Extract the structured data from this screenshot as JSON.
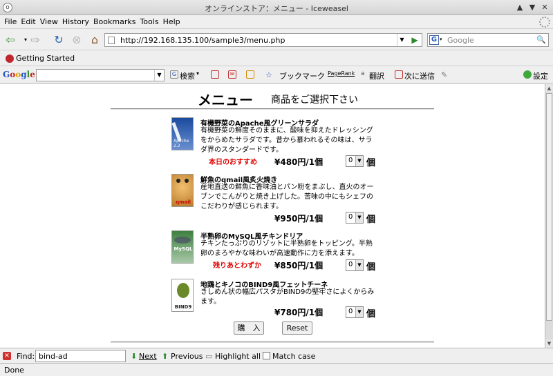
{
  "window": {
    "title": "オンラインストア：メニュー - Iceweasel"
  },
  "menubar": [
    "File",
    "Edit",
    "View",
    "History",
    "Bookmarks",
    "Tools",
    "Help"
  ],
  "nav": {
    "url": "http://192.168.135.100/sample3/menu.php",
    "search_placeholder": "Google"
  },
  "bookmarks": {
    "item": "Getting Started"
  },
  "google_toolbar": {
    "logo": "Google",
    "search": "検索",
    "bookmarks": "ブックマーク",
    "pagerank": "PageRank",
    "translate": "翻訳",
    "send": "次に送信",
    "settings": "設定"
  },
  "page": {
    "title": "メニュー",
    "subtitle": "商品をご選択下さい",
    "items": [
      {
        "name": "有機野菜のApache風グリーンサラダ",
        "desc": "有機野菜の鮮度そのままに、酸味を抑えたドレッシングをからめたサラダです。昔から慕われるその味は、サラダ界のスタンダードです。",
        "badge": "本日のおすすめ",
        "price": "¥480円/1個",
        "qty": "0",
        "unit": "個",
        "thumb_label": "Apache 2.2"
      },
      {
        "name": "鮮魚のqmail風炙火焼き",
        "desc": "産地直送の鮮魚に香味油とパン粉をまぶし、直火のオーブンでこんがりと焼き上げした。苦味の中にもシェフのこだわりが感じられます。",
        "badge": "",
        "price": "¥950円/1個",
        "qty": "0",
        "unit": "個",
        "thumb_label": "qmail"
      },
      {
        "name": "半熟卵のMySQL風チキンドリア",
        "desc": "チキンたっぷりのリゾットに半熟卵をトッピング。半熟卵のまろやかな味わいが高速動作に力を添えます。",
        "badge": "残りあとわずか",
        "price": "¥850円/1個",
        "qty": "0",
        "unit": "個",
        "thumb_label": "MySQL"
      },
      {
        "name": "地鶏とキノコのBIND9風フェットチーネ",
        "desc": "きしめん状の幅広パスタがBIND9の堅牢さによくからみます。",
        "badge": "",
        "price": "¥780円/1個",
        "qty": "0",
        "unit": "個",
        "thumb_label": "BIND9"
      }
    ],
    "buy_button": "購　入",
    "reset_button": "Reset"
  },
  "findbar": {
    "label": "Find:",
    "value": "bind-ad",
    "next": "Next",
    "previous": "Previous",
    "highlight": "Highlight  all",
    "matchcase": "Match  case"
  },
  "status": "Done"
}
